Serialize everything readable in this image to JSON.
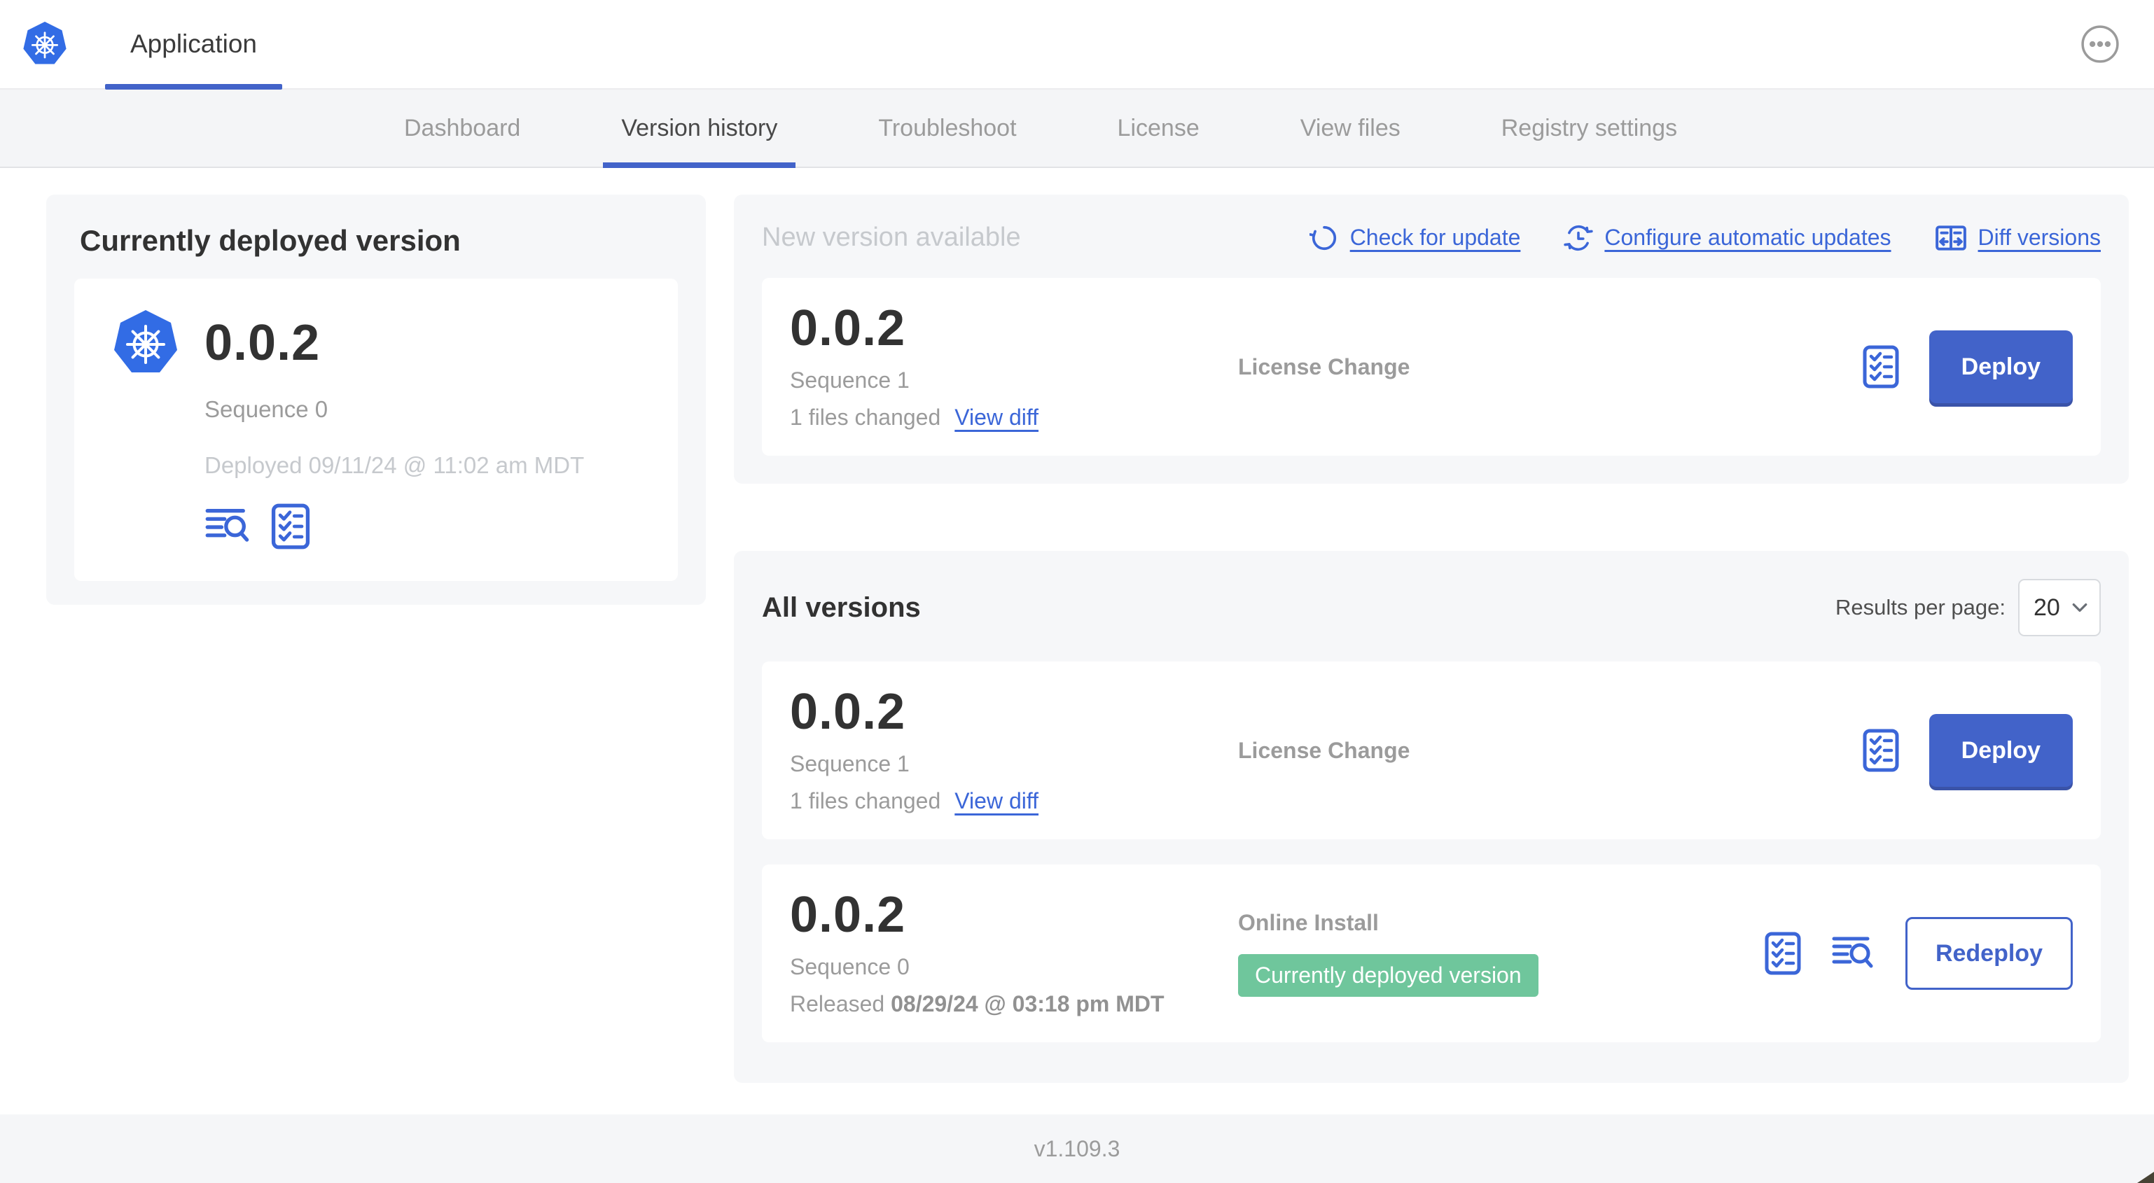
{
  "colors": {
    "accent_blue": "#4263c9",
    "link_blue": "#3b66d8",
    "kubernetes_blue": "#326ce5",
    "badge_green": "#6fc69c",
    "panel_gray": "#f6f7f9",
    "muted_text": "#9b9b9b"
  },
  "header": {
    "app_tab_label": "Application"
  },
  "nav_tabs": [
    {
      "label": "Dashboard",
      "active": false
    },
    {
      "label": "Version history",
      "active": true
    },
    {
      "label": "Troubleshoot",
      "active": false
    },
    {
      "label": "License",
      "active": false
    },
    {
      "label": "View files",
      "active": false
    },
    {
      "label": "Registry settings",
      "active": false
    }
  ],
  "current_version_panel": {
    "title": "Currently deployed version",
    "version": "0.0.2",
    "sequence": "Sequence 0",
    "deployed": "Deployed 09/11/24 @ 11:02 am MDT"
  },
  "new_version_panel": {
    "title": "New version available",
    "check_for_update_label": "Check for update",
    "configure_automatic_updates_label": "Configure automatic updates",
    "diff_versions_label": "Diff versions",
    "card": {
      "version": "0.0.2",
      "sequence": "Sequence 1",
      "files_changed": "1 files changed",
      "view_diff_label": "View diff",
      "source": "License Change",
      "action_label": "Deploy"
    }
  },
  "all_versions_panel": {
    "title": "All versions",
    "results_per_page_label": "Results per page:",
    "results_per_page_value": "20",
    "rows": [
      {
        "version": "0.0.2",
        "sequence": "Sequence 1",
        "files_changed": "1 files changed",
        "view_diff_label": "View diff",
        "source": "License Change",
        "action_label": "Deploy"
      },
      {
        "version": "0.0.2",
        "sequence": "Sequence 0",
        "released_prefix": "Released ",
        "released_date": "08/29/24 @ 03:18 pm MDT",
        "source": "Online Install",
        "badge": "Currently deployed version",
        "action_label": "Redeploy"
      }
    ]
  },
  "footer": {
    "app_version": "v1.109.3"
  },
  "icons": {
    "app_logo": "kubernetes-logo",
    "header_menu": "ellipsis-icon",
    "check_for_update": "refresh-ccw-icon",
    "configure_automatic_updates": "scheduled-update-icon",
    "diff_versions": "diff-columns-icon",
    "release_notes": "checklist-icon",
    "deploy_logs": "log-search-icon",
    "results_select": "chevron-down-icon"
  }
}
